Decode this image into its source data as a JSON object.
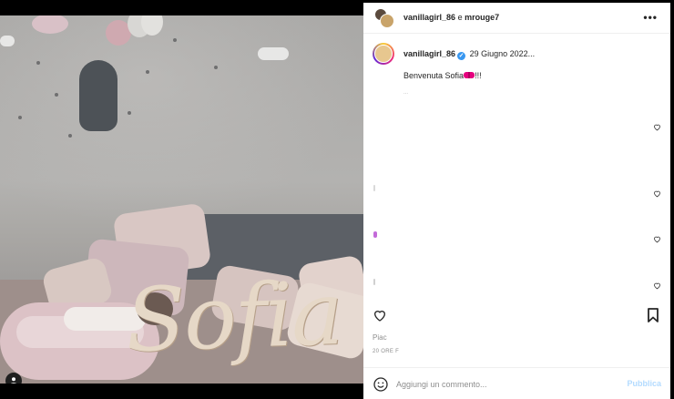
{
  "post": {
    "header": {
      "usernames": "vanillagirl_86",
      "separator": "e",
      "collaborator": "mrouge7",
      "more_icon": "more-horizontal-icon"
    },
    "caption": {
      "username": "vanillagirl_86",
      "date": "29 Giugno 2022...",
      "text": "Benvenuta Sofia",
      "emoji": "ribbon-icon",
      "suffix": "!!!",
      "extra": "..."
    },
    "photo_overlay_text": "Sofia",
    "likes_text": "Piac",
    "time_ago": "20 ORE F"
  },
  "comment_box": {
    "placeholder": "Aggiungi un commento...",
    "publish_label": "Pubblica"
  },
  "colors": {
    "accent_blue": "#3897f0",
    "publish_disabled": "#b3dbff",
    "border": "#efefef",
    "muted_text": "#8e8e8e"
  },
  "icons": {
    "like": "heart-icon",
    "save": "bookmark-icon",
    "emoji": "emoji-icon",
    "user_tag": "user-tag-icon"
  }
}
